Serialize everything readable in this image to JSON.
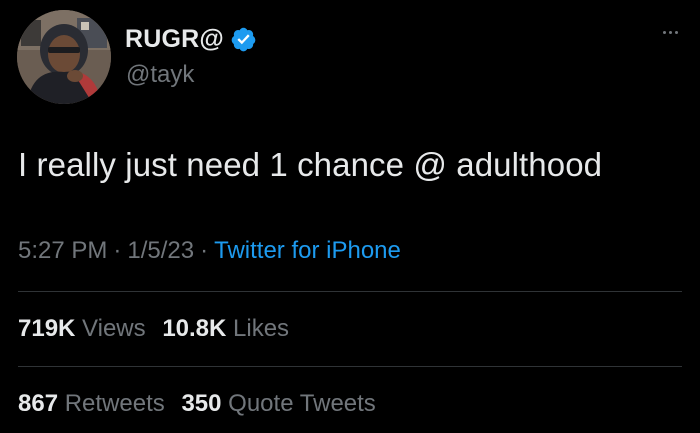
{
  "author": {
    "display_name": "RUGR@",
    "handle": "@tayk",
    "verified": true,
    "verified_icon": "verified-badge-icon"
  },
  "tweet": {
    "text": "I really just need 1 chance @ adulthood",
    "time": "5:27 PM",
    "date": "1/5/23",
    "separator": "·",
    "source": "Twitter for iPhone"
  },
  "stats": {
    "views_count": "719K",
    "views_label": "Views",
    "likes_count": "10.8K",
    "likes_label": "Likes",
    "retweets_count": "867",
    "retweets_label": "Retweets",
    "quotes_count": "350",
    "quotes_label": "Quote Tweets"
  },
  "colors": {
    "background": "#000000",
    "text_primary": "#e7e9ea",
    "text_secondary": "#71767b",
    "accent": "#1d9bf0",
    "divider": "#2f3336"
  }
}
